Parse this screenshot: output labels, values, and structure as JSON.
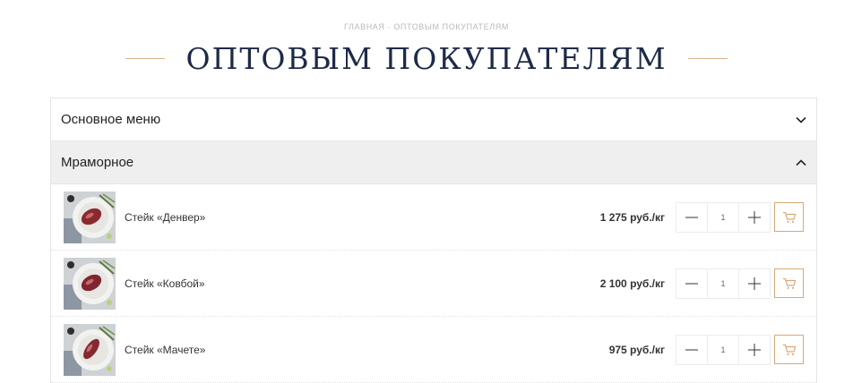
{
  "breadcrumb": {
    "home": "ГЛАВНАЯ",
    "separator": "·",
    "current": "ОПТОВЫМ ПОКУПАТЕЛЯМ"
  },
  "page": {
    "title": "ОПТОВЫМ ПОКУПАТЕЛЯМ"
  },
  "colors": {
    "accent": "#d8b48a",
    "cart_border": "#d9a877",
    "title": "#1f2a48",
    "open_bg": "#efefef"
  },
  "menu": {
    "sections": [
      {
        "label": "Основное меню",
        "icon": "chevron-down-icon",
        "expanded": false
      },
      {
        "label": "Мраморное",
        "icon": "chevron-up-icon",
        "expanded": true
      }
    ]
  },
  "products": [
    {
      "name": "Стейк «Денвер»",
      "price": "1 275 руб./кг",
      "qty": "1",
      "image": "steak-plate-image"
    },
    {
      "name": "Стейк «Ковбой»",
      "price": "2 100 руб./кг",
      "qty": "1",
      "image": "steak-plate-image"
    },
    {
      "name": "Стейк «Мачете»",
      "price": "975 руб./кг",
      "qty": "1",
      "image": "steak-plate-image"
    }
  ]
}
